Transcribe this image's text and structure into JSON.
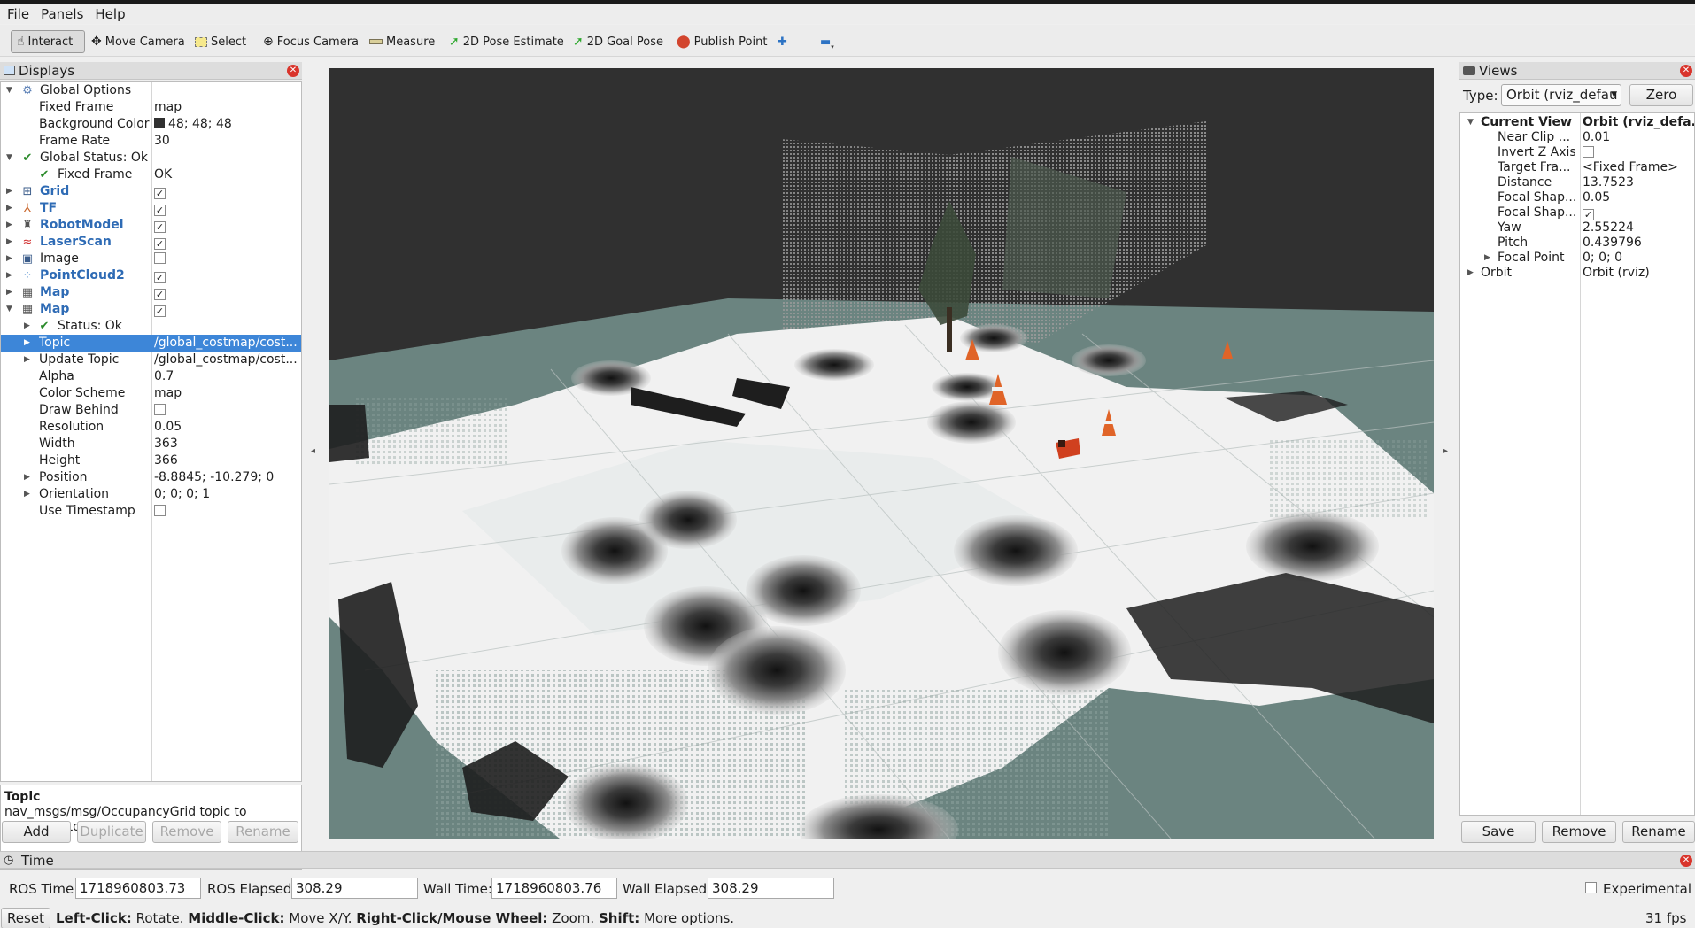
{
  "menu": [
    "File",
    "Panels",
    "Help"
  ],
  "toolbar": {
    "interact": "Interact",
    "move_camera": "Move Camera",
    "select": "Select",
    "focus_camera": "Focus Camera",
    "measure": "Measure",
    "pose_estimate": "2D Pose Estimate",
    "goal_pose": "2D Goal Pose",
    "publish_point": "Publish Point"
  },
  "displays": {
    "title": "Displays",
    "rows": [
      {
        "name": "Global Options",
        "value": ""
      },
      {
        "name": "Fixed Frame",
        "value": "map"
      },
      {
        "name": "Background Color",
        "value": "48; 48; 48"
      },
      {
        "name": "Frame Rate",
        "value": "30"
      },
      {
        "name": "Global Status: Ok",
        "value": ""
      },
      {
        "name": "Fixed Frame",
        "value": "OK"
      },
      {
        "name": "Grid",
        "value": ""
      },
      {
        "name": "TF",
        "value": ""
      },
      {
        "name": "RobotModel",
        "value": ""
      },
      {
        "name": "LaserScan",
        "value": ""
      },
      {
        "name": "Image",
        "value": ""
      },
      {
        "name": "PointCloud2",
        "value": ""
      },
      {
        "name": "Map",
        "value": ""
      },
      {
        "name": "Map",
        "value": ""
      },
      {
        "name": "Status: Ok",
        "value": ""
      },
      {
        "name": "Topic",
        "value": "/global_costmap/cost..."
      },
      {
        "name": "Update Topic",
        "value": "/global_costmap/cost..."
      },
      {
        "name": "Alpha",
        "value": "0.7"
      },
      {
        "name": "Color Scheme",
        "value": "map"
      },
      {
        "name": "Draw Behind",
        "value": ""
      },
      {
        "name": "Resolution",
        "value": "0.05"
      },
      {
        "name": "Width",
        "value": "363"
      },
      {
        "name": "Height",
        "value": "366"
      },
      {
        "name": "Position",
        "value": "-8.8845; -10.279; 0"
      },
      {
        "name": "Orientation",
        "value": "0; 0; 0; 1"
      },
      {
        "name": "Use Timestamp",
        "value": ""
      }
    ],
    "checks": {
      "Grid": true,
      "TF": true,
      "RobotModel": true,
      "LaserScan": true,
      "Image": false,
      "PointCloud2": true,
      "Map1": true,
      "Map2": true,
      "DrawBehind": false,
      "UseTimestamp": false
    },
    "background_color": "#303030",
    "help_title": "Topic",
    "help_text": "nav_msgs/msg/OccupancyGrid topic to subscribe to.",
    "buttons": {
      "add": "Add",
      "duplicate": "Duplicate",
      "remove": "Remove",
      "rename": "Rename"
    }
  },
  "views": {
    "title": "Views",
    "type_label": "Type:",
    "type_value": "Orbit (rviz_defau",
    "zero": "Zero",
    "rows": [
      {
        "name": "Current View",
        "value": "Orbit (rviz_defa..."
      },
      {
        "name": "Near Clip ...",
        "value": "0.01"
      },
      {
        "name": "Invert Z Axis",
        "value": ""
      },
      {
        "name": "Target Fra...",
        "value": "<Fixed Frame>"
      },
      {
        "name": "Distance",
        "value": "13.7523"
      },
      {
        "name": "Focal Shap...",
        "value": "0.05"
      },
      {
        "name": "Focal Shap...",
        "value": ""
      },
      {
        "name": "Yaw",
        "value": "2.55224"
      },
      {
        "name": "Pitch",
        "value": "0.439796"
      },
      {
        "name": "Focal Point",
        "value": "0; 0; 0"
      },
      {
        "name": "Orbit",
        "value": "Orbit (rviz)"
      }
    ],
    "checks": {
      "invert_z": false,
      "focal_shape_fixed": true
    },
    "buttons": {
      "save": "Save",
      "remove": "Remove",
      "rename": "Rename"
    }
  },
  "time": {
    "title": "Time",
    "ros_time_label": "ROS Time:",
    "ros_time": "1718960803.73",
    "ros_elapsed_label": "ROS Elapsed:",
    "ros_elapsed": "308.29",
    "wall_time_label": "Wall Time:",
    "wall_time": "1718960803.76",
    "wall_elapsed_label": "Wall Elapsed:",
    "wall_elapsed": "308.29",
    "experimental": "Experimental",
    "experimental_checked": false
  },
  "status": {
    "reset": "Reset",
    "left_click": "Left-Click:",
    "left_click_desc": "Rotate.",
    "middle_click": "Middle-Click:",
    "middle_click_desc": "Move X/Y.",
    "right_click": "Right-Click/Mouse Wheel:",
    "right_click_desc": "Zoom.",
    "shift": "Shift:",
    "shift_desc": "More options.",
    "fps": "31 fps"
  }
}
